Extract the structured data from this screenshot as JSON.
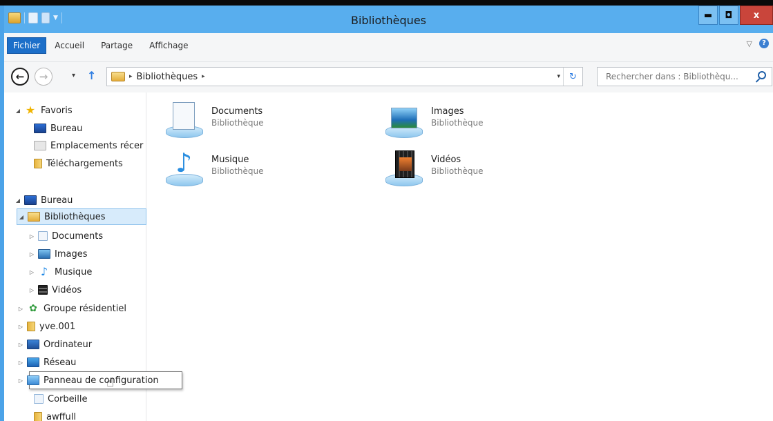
{
  "window": {
    "title": "Bibliothèques"
  },
  "quick_access": {
    "icons": [
      "folder-icon",
      "properties-icon",
      "new-folder-icon",
      "customize-dropdown-icon"
    ]
  },
  "window_buttons": {
    "minimize": "▬",
    "maximize": "◘",
    "close": "x"
  },
  "ribbon": {
    "tabs": [
      {
        "label": "Fichier",
        "active": true
      },
      {
        "label": "Accueil"
      },
      {
        "label": "Partage"
      },
      {
        "label": "Affichage"
      }
    ],
    "expand_glyph": "▽",
    "help_glyph": "?"
  },
  "navigation": {
    "back_glyph": "←",
    "forward_glyph": "→",
    "recent_glyph": "▾",
    "up_glyph": "↑",
    "path_sep": "▸",
    "path": [
      "Bibliothèques"
    ],
    "address_dropdown": "▾",
    "refresh_glyph": "↻",
    "search_placeholder": "Rechercher dans : Bibliothèqu..."
  },
  "nav_pane": {
    "favorites": {
      "label": "Favoris",
      "items": [
        "Bureau",
        "Emplacements récer",
        "Téléchargements"
      ]
    },
    "desktop": {
      "label": "Bureau",
      "libraries_label": "Bibliothèques",
      "library_items": [
        "Documents",
        "Images",
        "Musique",
        "Vidéos"
      ],
      "other_items": [
        "Groupe résidentiel",
        "yve.001",
        "Ordinateur",
        "Réseau",
        "Panneau de configuration",
        "Corbeille",
        "awffull"
      ]
    },
    "expand_glyph": "▷",
    "collapse_glyph": "◢"
  },
  "libraries": [
    {
      "name": "Documents",
      "type": "Bibliothèque",
      "icon": "documents-library-icon"
    },
    {
      "name": "Images",
      "type": "Bibliothèque",
      "icon": "images-library-icon"
    },
    {
      "name": "Musique",
      "type": "Bibliothèque",
      "icon": "music-library-icon"
    },
    {
      "name": "Vidéos",
      "type": "Bibliothèque",
      "icon": "videos-library-icon"
    }
  ],
  "colors": {
    "titlebar": "#58aeee",
    "file_tab": "#1c6fc9",
    "close_button": "#c9453b",
    "selection": "#d7ebfb"
  }
}
